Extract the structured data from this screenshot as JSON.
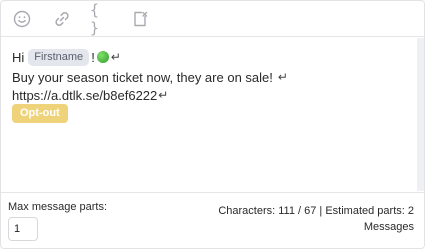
{
  "toolbar": {
    "buttons": [
      {
        "icon": "emoji-icon"
      },
      {
        "icon": "link-icon"
      },
      {
        "icon": "variable-braces-icon",
        "label": "{ }"
      },
      {
        "icon": "clear-format-icon"
      }
    ]
  },
  "message": {
    "greeting": "Hi",
    "placeholder_tag": "Firstname",
    "exclamation": "!",
    "emoji": "green-circle",
    "line2": "Buy your season ticket now, they are on sale!",
    "line3": "https://a.dtlk.se/b8ef6222",
    "return_symbol": "↵",
    "optout_label": "Opt-out"
  },
  "footer": {
    "max_parts_label": "Max message parts:",
    "max_parts_value": "1",
    "characters_text": "Characters: 111 / 67 | Estimated parts: 2",
    "messages_text": "Messages"
  },
  "colors": {
    "optout_bg": "#efd37a",
    "tag_bg": "#e4e6ee",
    "icon_gray": "#a9a9b0"
  }
}
